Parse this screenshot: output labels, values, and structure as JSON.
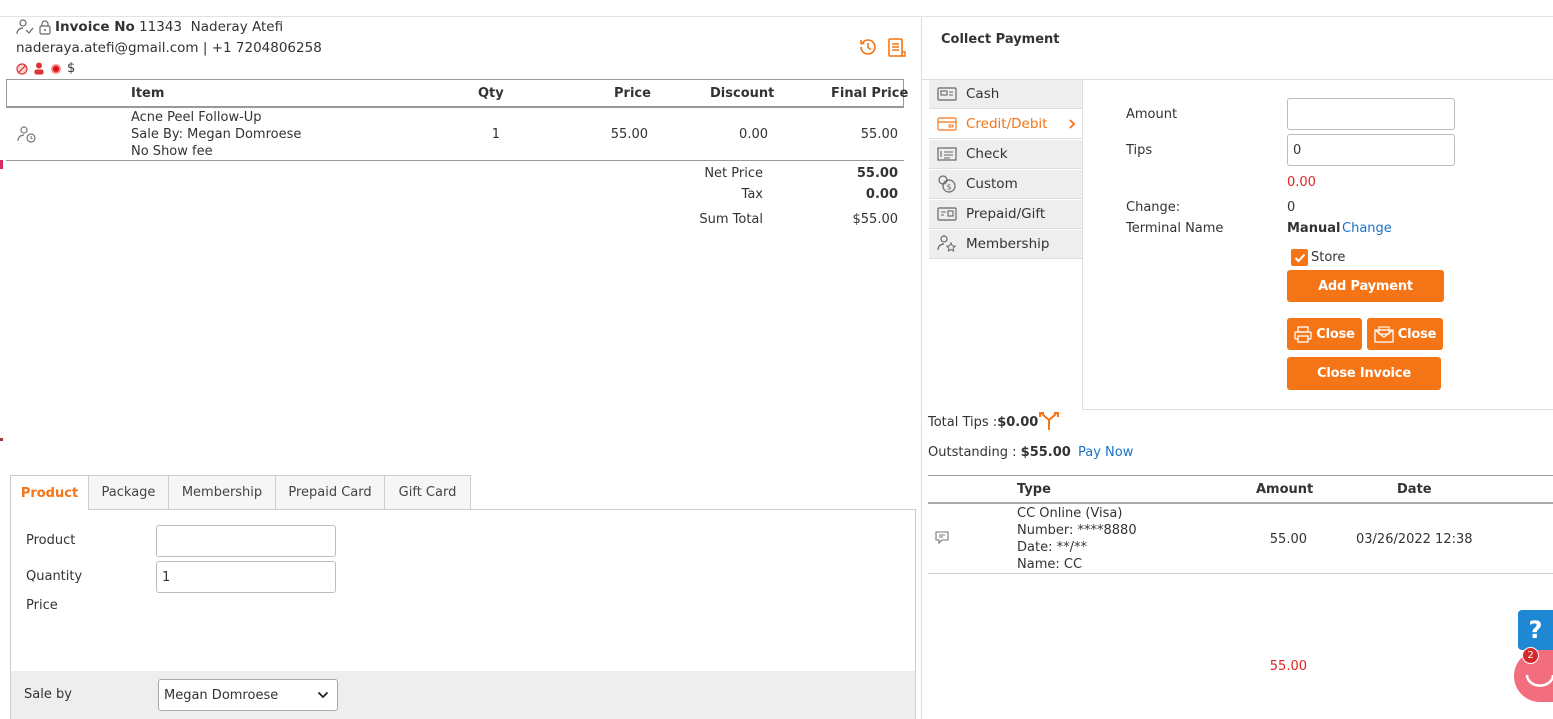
{
  "invoice": {
    "label": "Invoice No",
    "number": "11343",
    "client_name": "Naderay Atefi",
    "contact": "naderaya.atefi@gmail.com | +1 7204806258",
    "currency_symbol": "$"
  },
  "items_table": {
    "headers": [
      "Item",
      "Qty",
      "Price",
      "Discount",
      "Final Price"
    ],
    "rows": [
      {
        "item_name": "Acne Peel Follow-Up",
        "sale_by": "Sale By: Megan Domroese",
        "note": "No Show fee",
        "qty": "1",
        "price": "55.00",
        "discount": "0.00",
        "final_price": "55.00"
      }
    ]
  },
  "totals": {
    "net_price_label": "Net Price",
    "net_price": "55.00",
    "tax_label": "Tax",
    "tax": "0.00",
    "sum_total_label": "Sum Total",
    "sum_total": "$55.00"
  },
  "product_tabs": [
    "Product",
    "Package",
    "Membership",
    "Prepaid Card",
    "Gift Card"
  ],
  "product_form": {
    "product_label": "Product",
    "product_value": "",
    "quantity_label": "Quantity",
    "quantity_value": "1",
    "price_label": "Price",
    "sale_by_label": "Sale by",
    "sale_by_value": "Megan Domroese"
  },
  "collect_payment": {
    "title": "Collect Payment",
    "methods": [
      {
        "label": "Cash",
        "icon": "cash-register-icon"
      },
      {
        "label": "Credit/Debit",
        "icon": "credit-card-icon"
      },
      {
        "label": "Check",
        "icon": "check-icon"
      },
      {
        "label": "Custom",
        "icon": "coins-icon"
      },
      {
        "label": "Prepaid/Gift",
        "icon": "gift-card-icon"
      },
      {
        "label": "Membership",
        "icon": "membership-icon"
      }
    ],
    "active_method": "Credit/Debit",
    "amount_label": "Amount",
    "amount_value": "",
    "tips_label": "Tips",
    "tips_value": "0",
    "red_amount": "0.00",
    "change_label": "Change:",
    "change_value": "0",
    "terminal_label": "Terminal Name",
    "terminal_value": "Manual",
    "terminal_change_link": "Change",
    "store_label": "Store",
    "store_checked": true,
    "add_payment_label": "Add Payment",
    "close_print_label": "Close",
    "close_email_label": "Close",
    "close_invoice_label": "Close Invoice"
  },
  "summary": {
    "total_tips_label": "Total Tips :",
    "total_tips_value": "$0.00",
    "outstanding_label": "Outstanding :",
    "outstanding_value": "$55.00",
    "pay_now_label": "Pay Now"
  },
  "payments_table": {
    "headers": [
      "Type",
      "Amount",
      "Date"
    ],
    "rows": [
      {
        "type_line1": "CC Online (Visa)",
        "type_line2": "Number: ****8880",
        "type_line3": "Date: **/**",
        "type_line4": "Name: CC",
        "amount": "55.00",
        "date": "03/26/2022 12:38"
      }
    ],
    "total": "55.00"
  },
  "help_widget": {
    "label": "?",
    "badge_count": "2"
  },
  "colors": {
    "accent": "#f57416",
    "link": "#1a73c8",
    "alert_red": "#e02424",
    "help_blue": "#1e88d4"
  }
}
